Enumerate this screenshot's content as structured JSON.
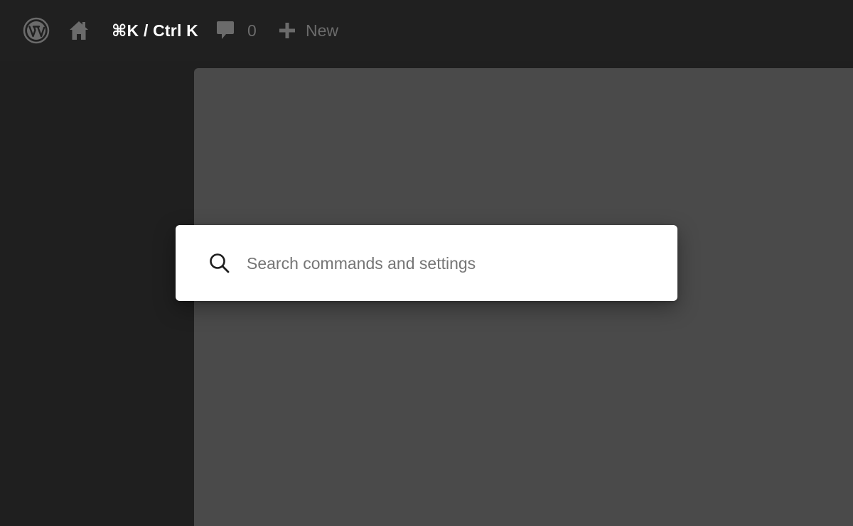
{
  "admin_bar": {
    "logo_icon": "wordpress-logo-icon",
    "home_icon": "home-icon",
    "shortcut_label": "⌘K / Ctrl K",
    "comments_icon": "comment-bubble-icon",
    "comments_count": "0",
    "new_icon": "plus-icon",
    "new_label": "New"
  },
  "command_palette": {
    "search_icon": "search-icon",
    "placeholder": "Search commands and settings",
    "value": ""
  },
  "colors": {
    "admin_bar_bg": "#202020",
    "sidebar_bg": "#1f1f1f",
    "content_bg": "#4a4a4a",
    "palette_bg": "#ffffff",
    "muted_text": "#6b6b6b",
    "shortcut_text": "#ffffff"
  }
}
